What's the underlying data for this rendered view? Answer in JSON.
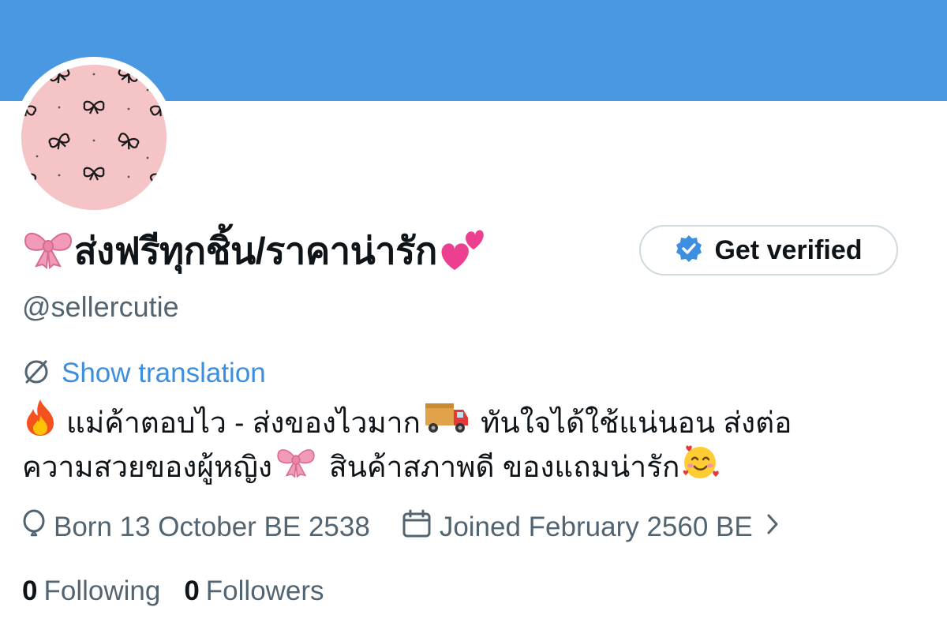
{
  "profile": {
    "display_name": "ส่งฟรีทุกชิ้น/ราคาน่ารัก",
    "handle": "@sellercutie",
    "get_verified_label": "Get verified",
    "show_translation_label": "Show translation",
    "bio": {
      "line1_part1": "แม่ค้าตอบไว - ส่งของไวมาก",
      "line1_part2": "ทันใจได้ใช้แน่นอน ส่งต่อ",
      "line2_part1": "ความสวยของผู้หญิง",
      "line2_part2": "สินค้าสภาพดี ของแถมน่ารัก"
    },
    "born": "Born 13 October BE 2538",
    "joined": "Joined February 2560 BE",
    "following_count": "0",
    "following_label": "Following",
    "followers_count": "0",
    "followers_label": "Followers"
  },
  "icons": [
    "bow-emoji",
    "two-hearts-emoji",
    "verified-badge-icon",
    "translate-icon",
    "fire-emoji",
    "truck-emoji",
    "smiling-hearts-emoji",
    "birthday-icon",
    "calendar-icon",
    "chevron-right-icon"
  ],
  "colors": {
    "banner": "#4a97e2",
    "link": "#3b8fde",
    "secondary_text": "#536471",
    "avatar_bg": "#f5c4c7",
    "verified_badge": "#3d8fe0"
  }
}
